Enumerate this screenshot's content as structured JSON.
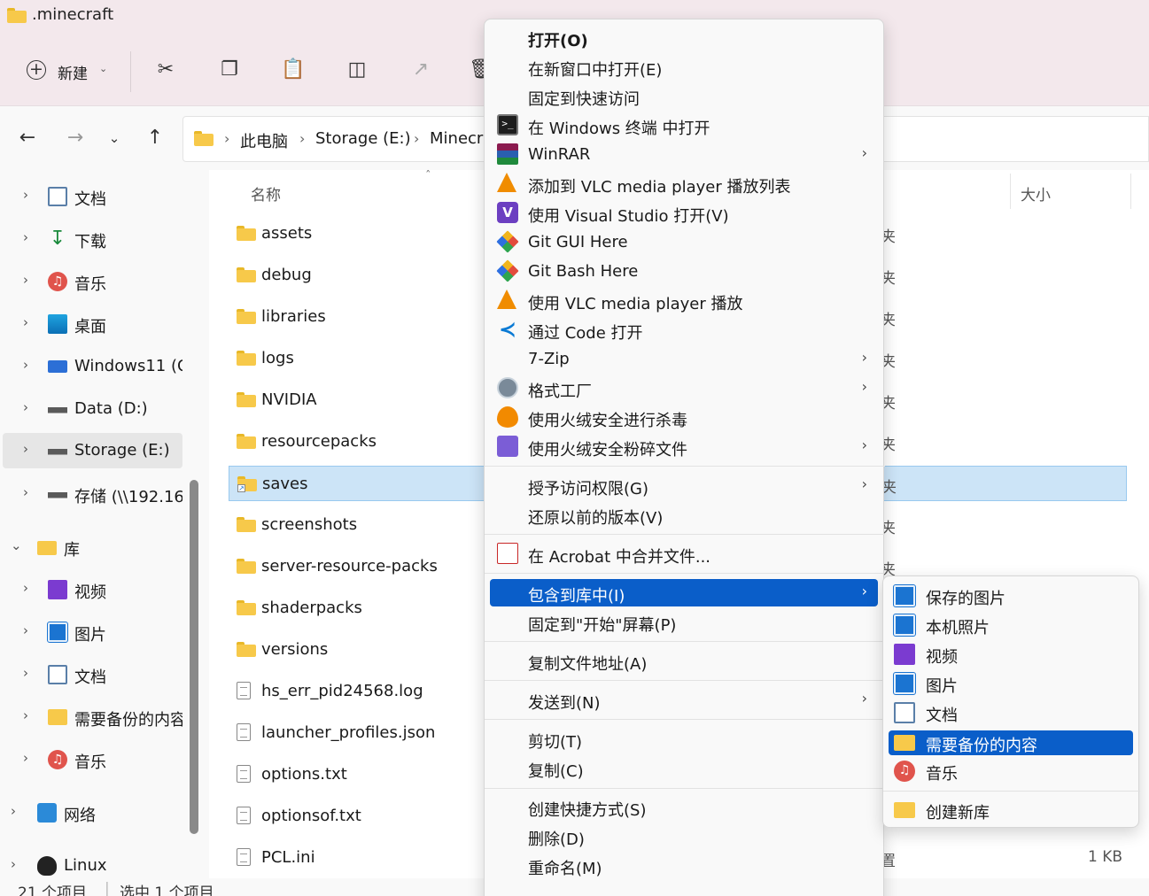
{
  "window": {
    "title": ".minecraft"
  },
  "commandbar": {
    "new_label": "新建"
  },
  "address": {
    "crumbs": [
      "此电脑",
      "Storage (E:)",
      "Minecr"
    ]
  },
  "navpane": {
    "items": [
      {
        "label": "文档",
        "icon": "document-icon"
      },
      {
        "label": "下载",
        "icon": "download-icon"
      },
      {
        "label": "音乐",
        "icon": "music-icon"
      },
      {
        "label": "桌面",
        "icon": "desktop-icon"
      },
      {
        "label": "Windows11 (C",
        "icon": "windows-drive-icon"
      },
      {
        "label": "Data (D:)",
        "icon": "drive-icon"
      },
      {
        "label": "Storage (E:)",
        "icon": "drive-icon"
      },
      {
        "label": "存储 (\\\\192.16",
        "icon": "network-drive-icon"
      },
      {
        "label": "库",
        "icon": "library-icon"
      },
      {
        "label": "视频",
        "icon": "video-icon"
      },
      {
        "label": "图片",
        "icon": "picture-icon"
      },
      {
        "label": "文档",
        "icon": "document-icon"
      },
      {
        "label": "需要备份的内容",
        "icon": "library-folder-icon"
      },
      {
        "label": "音乐",
        "icon": "music-icon"
      },
      {
        "label": "网络",
        "icon": "network-icon"
      },
      {
        "label": "Linux",
        "icon": "linux-icon"
      }
    ]
  },
  "filelist": {
    "headers": {
      "name": "名称",
      "size": "大小"
    },
    "rows": [
      {
        "name": "assets",
        "type": "folder",
        "right": "夹"
      },
      {
        "name": "debug",
        "type": "folder",
        "right": "夹"
      },
      {
        "name": "libraries",
        "type": "folder",
        "right": "夹"
      },
      {
        "name": "logs",
        "type": "folder",
        "right": "夹"
      },
      {
        "name": "NVIDIA",
        "type": "folder",
        "right": "夹"
      },
      {
        "name": "resourcepacks",
        "type": "folder",
        "right": "夹"
      },
      {
        "name": "saves",
        "type": "folder-shortcut",
        "right": "夹"
      },
      {
        "name": "screenshots",
        "type": "folder",
        "right": "夹"
      },
      {
        "name": "server-resource-packs",
        "type": "folder",
        "right": "夹"
      },
      {
        "name": "shaderpacks",
        "type": "folder",
        "right": "夹"
      },
      {
        "name": "versions",
        "type": "folder",
        "right": "夹"
      },
      {
        "name": "hs_err_pid24568.log",
        "type": "file",
        "right": ""
      },
      {
        "name": "launcher_profiles.json",
        "type": "json",
        "right": ""
      },
      {
        "name": "options.txt",
        "type": "file",
        "right": ""
      },
      {
        "name": "optionsof.txt",
        "type": "file",
        "right": ""
      },
      {
        "name": "PCL.ini",
        "type": "ini",
        "right": "置",
        "size": "1 KB"
      }
    ]
  },
  "status": {
    "count": "21 个项目",
    "selected": "选中 1 个项目"
  },
  "context_menu": {
    "items": [
      {
        "label": "打开(O)",
        "bold": true,
        "icon": ""
      },
      {
        "label": "在新窗口中打开(E)",
        "icon": ""
      },
      {
        "label": "固定到快速访问",
        "icon": ""
      },
      {
        "label": "在 Windows 终端 中打开",
        "icon": "terminal-icon"
      },
      {
        "label": "WinRAR",
        "icon": "winrar-icon",
        "submenu": true
      },
      {
        "label": "添加到 VLC media player 播放列表",
        "icon": "vlc-icon"
      },
      {
        "label": "使用 Visual Studio 打开(V)",
        "icon": "visual-studio-icon"
      },
      {
        "label": "Git GUI Here",
        "icon": "git-icon"
      },
      {
        "label": "Git Bash Here",
        "icon": "git-icon"
      },
      {
        "label": "使用 VLC media player 播放",
        "icon": "vlc-icon"
      },
      {
        "label": "通过 Code 打开",
        "icon": "vscode-icon"
      },
      {
        "label": "7-Zip",
        "icon": "",
        "submenu": true
      },
      {
        "label": "格式工厂",
        "icon": "format-factory-icon",
        "submenu": true
      },
      {
        "label": "使用火绒安全进行杀毒",
        "icon": "huorong-icon"
      },
      {
        "label": "使用火绒安全粉碎文件",
        "icon": "shredder-icon",
        "submenu": true
      },
      {
        "label": "授予访问权限(G)",
        "icon": "",
        "submenu": true
      },
      {
        "label": "还原以前的版本(V)",
        "icon": ""
      },
      {
        "label": "在 Acrobat 中合并文件...",
        "icon": "acrobat-icon"
      },
      {
        "label": "包含到库中(I)",
        "icon": "",
        "submenu": true,
        "highlighted": true
      },
      {
        "label": "固定到\"开始\"屏幕(P)",
        "icon": ""
      },
      {
        "label": "复制文件地址(A)",
        "icon": ""
      },
      {
        "label": "发送到(N)",
        "icon": "",
        "submenu": true
      },
      {
        "label": "剪切(T)",
        "icon": ""
      },
      {
        "label": "复制(C)",
        "icon": ""
      },
      {
        "label": "创建快捷方式(S)",
        "icon": ""
      },
      {
        "label": "删除(D)",
        "icon": ""
      },
      {
        "label": "重命名(M)",
        "icon": ""
      }
    ]
  },
  "submenu": {
    "items": [
      {
        "label": "保存的图片",
        "icon": "picture-icon"
      },
      {
        "label": "本机照片",
        "icon": "picture-icon"
      },
      {
        "label": "视频",
        "icon": "video-icon"
      },
      {
        "label": "图片",
        "icon": "picture-icon"
      },
      {
        "label": "文档",
        "icon": "document-icon"
      },
      {
        "label": "需要备份的内容",
        "icon": "library-folder-icon",
        "highlighted": true
      },
      {
        "label": "音乐",
        "icon": "music-icon"
      },
      {
        "label": "创建新库",
        "icon": "new-library-icon"
      }
    ]
  },
  "colors": {
    "accent": "#0a5ec9",
    "selection": "#cce4f7",
    "titlebar": "#f3e8ec"
  }
}
